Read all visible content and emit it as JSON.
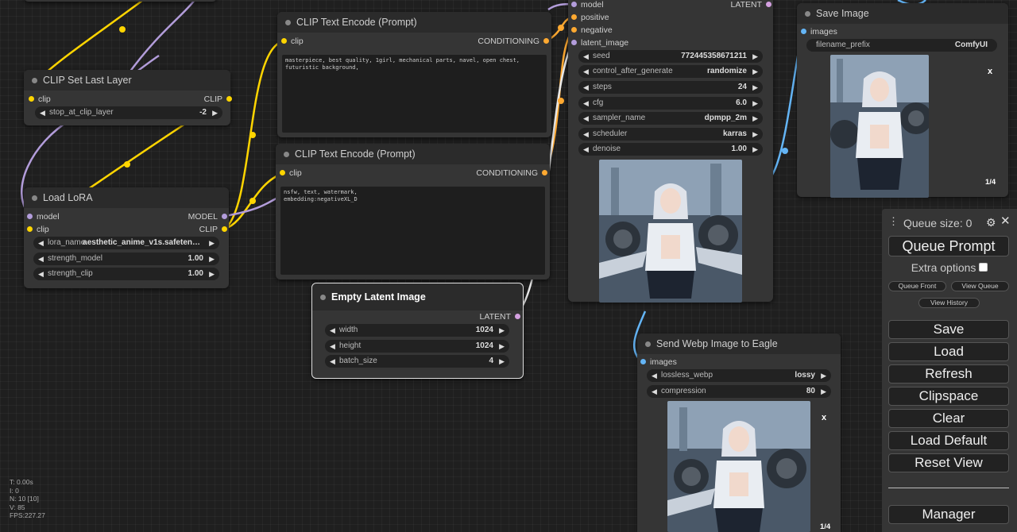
{
  "colors": {
    "clip": "#ffd500",
    "conditioning": "#ffa931",
    "model": "#b39ddb",
    "latent": "#d4a0e0",
    "image": "#64b5f6"
  },
  "clip_set_last_layer": {
    "title": "CLIP Set Last Layer",
    "in_clip": "clip",
    "out_clip": "CLIP",
    "stop_at_clip_layer": {
      "name": "stop_at_clip_layer",
      "value": "-2"
    }
  },
  "load_lora": {
    "title": "Load LoRA",
    "in_model": "model",
    "in_clip": "clip",
    "out_model": "MODEL",
    "out_clip": "CLIP",
    "lora_name": {
      "name": "lora_name",
      "value": "aesthetic_anime_v1s.safeten…"
    },
    "strength_model": {
      "name": "strength_model",
      "value": "1.00"
    },
    "strength_clip": {
      "name": "strength_clip",
      "value": "1.00"
    }
  },
  "clip_text_pos": {
    "title": "CLIP Text Encode (Prompt)",
    "in_clip": "clip",
    "out": "CONDITIONING",
    "text": "masterpiece, best quality, 1girl, mechanical parts, navel, open chest,\nfuturistic background,"
  },
  "clip_text_neg": {
    "title": "CLIP Text Encode (Prompt)",
    "in_clip": "clip",
    "out": "CONDITIONING",
    "text": "nsfw, text, watermark,\nembedding:negativeXL_D"
  },
  "empty_latent": {
    "title": "Empty Latent Image",
    "out": "LATENT",
    "width": {
      "name": "width",
      "value": "1024"
    },
    "height": {
      "name": "height",
      "value": "1024"
    },
    "batch_size": {
      "name": "batch_size",
      "value": "4"
    }
  },
  "ksampler": {
    "in_model": "model",
    "in_positive": "positive",
    "in_negative": "negative",
    "in_latent": "latent_image",
    "out": "LATENT",
    "seed": {
      "name": "seed",
      "value": "772445358671211"
    },
    "control_after_generate": {
      "name": "control_after_generate",
      "value": "randomize"
    },
    "steps": {
      "name": "steps",
      "value": "24"
    },
    "cfg": {
      "name": "cfg",
      "value": "6.0"
    },
    "sampler_name": {
      "name": "sampler_name",
      "value": "dpmpp_2m"
    },
    "scheduler": {
      "name": "scheduler",
      "value": "karras"
    },
    "denoise": {
      "name": "denoise",
      "value": "1.00"
    }
  },
  "save_image": {
    "title": "Save Image",
    "in_images": "images",
    "filename_prefix": {
      "name": "filename_prefix",
      "value": "ComfyUI"
    },
    "close": "x",
    "counter": "1/4"
  },
  "eagle": {
    "title": "Send Webp Image to Eagle",
    "in_images": "images",
    "lossless_webp": {
      "name": "lossless_webp",
      "value": "lossy"
    },
    "compression": {
      "name": "compression",
      "value": "80"
    },
    "close": "x",
    "counter": "1/4"
  },
  "queue_panel": {
    "queue_size": "Queue size: 0",
    "queue_prompt": "Queue Prompt",
    "extra_options": "Extra options",
    "queue_front": "Queue Front",
    "view_queue": "View Queue",
    "view_history": "View History",
    "save": "Save",
    "load": "Load",
    "refresh": "Refresh",
    "clipspace": "Clipspace",
    "clear": "Clear",
    "load_default": "Load Default",
    "reset_view": "Reset View",
    "manager": "Manager"
  },
  "stats": {
    "t": "T: 0.00s",
    "i": "I: 0",
    "n": "N: 10 [10]",
    "v": "V: 85",
    "fps": "FPS:227.27"
  }
}
